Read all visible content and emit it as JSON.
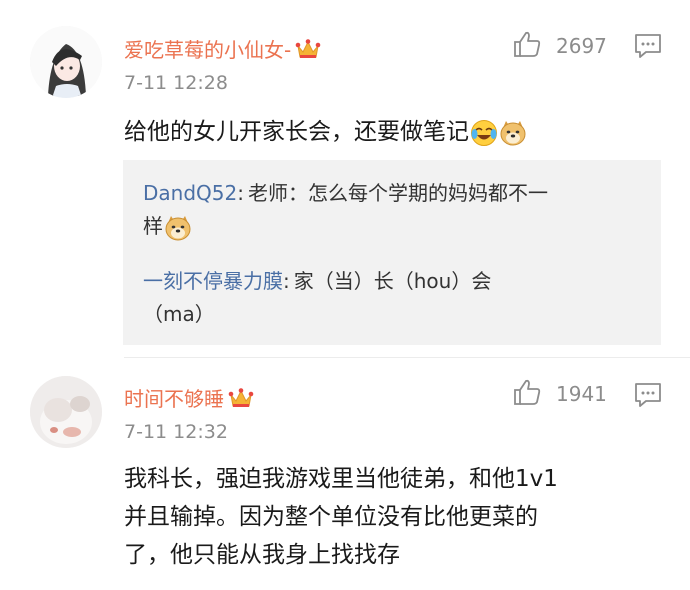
{
  "comments": [
    {
      "username": "爱吃草莓的小仙女-",
      "likes": "2697",
      "time": "7-11 12:28",
      "text": "给他的女儿开家长会，还要做笔记",
      "replies": [
        {
          "user": "DandQ52",
          "sep": ":",
          "text_line1": "老师：怎么每个学期的妈妈都不一",
          "text_line2": "样"
        },
        {
          "user": "一刻不停暴力膜",
          "sep": ":",
          "text_line1": "家（当）长（hou）会",
          "text_line2": "（ma）"
        }
      ]
    },
    {
      "username": "时间不够睡",
      "likes": "1941",
      "time": "7-11 12:32",
      "text_lines": [
        "我科长，强迫我游戏里当他徒弟，和他1v1",
        "并且输掉。因为整个单位没有比他更菜的",
        "了，他只能从我身上找找存"
      ]
    }
  ],
  "icons": {
    "like": "thumbs-up-icon",
    "comment": "comment-icon",
    "crown": "crown-icon",
    "laugh_cry": "laugh-cry-emoji-icon",
    "doge": "doge-emoji-icon"
  },
  "colors": {
    "username": "#eb7350",
    "link": "#4a6fa5",
    "meta": "#8c8c8c",
    "reply_bg": "#f2f2f2"
  }
}
